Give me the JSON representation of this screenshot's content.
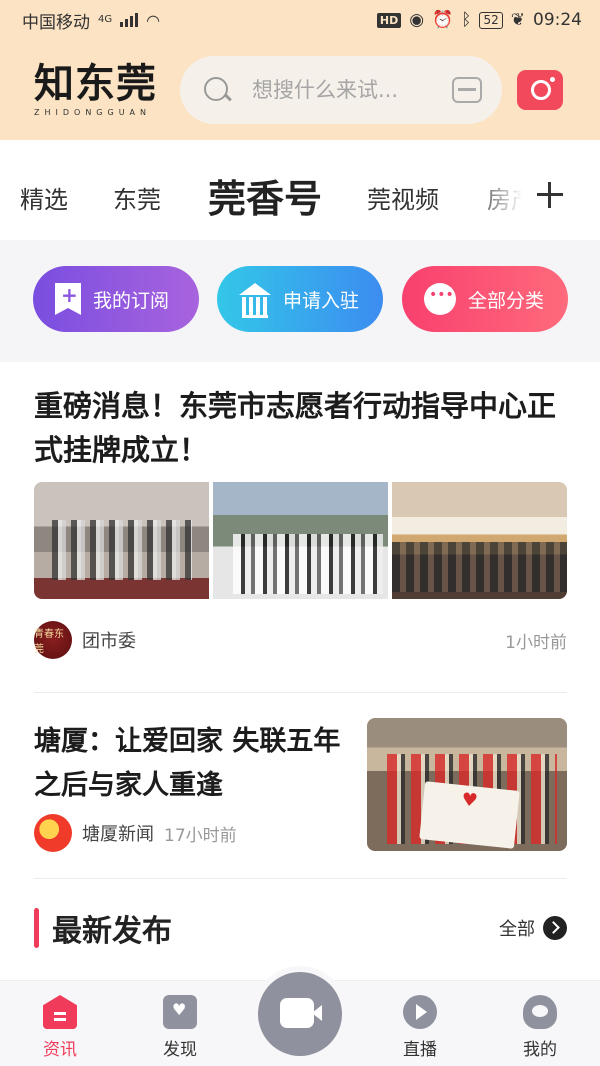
{
  "status_bar": {
    "carrier": "中国移动",
    "network": "4G",
    "hd": "HD",
    "battery": "52",
    "time": "09:24"
  },
  "header": {
    "logo_cn": "知东莞",
    "logo_en": "ZHIDONGGUAN",
    "search_placeholder": "想搜什么来试..."
  },
  "tabs": [
    {
      "label": "精选"
    },
    {
      "label": "东莞"
    },
    {
      "label": "莞香号",
      "active": true
    },
    {
      "label": "莞视频"
    },
    {
      "label": "房产"
    }
  ],
  "quick_actions": [
    {
      "label": "我的订阅",
      "icon": "bookmark-plus-icon"
    },
    {
      "label": "申请入驻",
      "icon": "building-icon"
    },
    {
      "label": "全部分类",
      "icon": "more-dots-icon"
    }
  ],
  "articles": [
    {
      "title": "重磅消息！东莞市志愿者行动指导中心正式挂牌成立！",
      "source": "团市委",
      "avatar_text": "青春东莞",
      "time": "1小时前"
    },
    {
      "title": "塘厦：让爱回家 失联五年之后与家人重逢",
      "source": "塘厦新闻",
      "time": "17小时前"
    }
  ],
  "latest": {
    "title": "最新发布",
    "all_label": "全部"
  },
  "bottom_nav": [
    {
      "label": "资讯",
      "active": true
    },
    {
      "label": "发现"
    },
    {
      "label": "直播"
    },
    {
      "label": "我的"
    }
  ],
  "colors": {
    "header_bg": "#fbe3c4",
    "accent": "#f03c5a",
    "inactive_icon": "#8f929e"
  }
}
